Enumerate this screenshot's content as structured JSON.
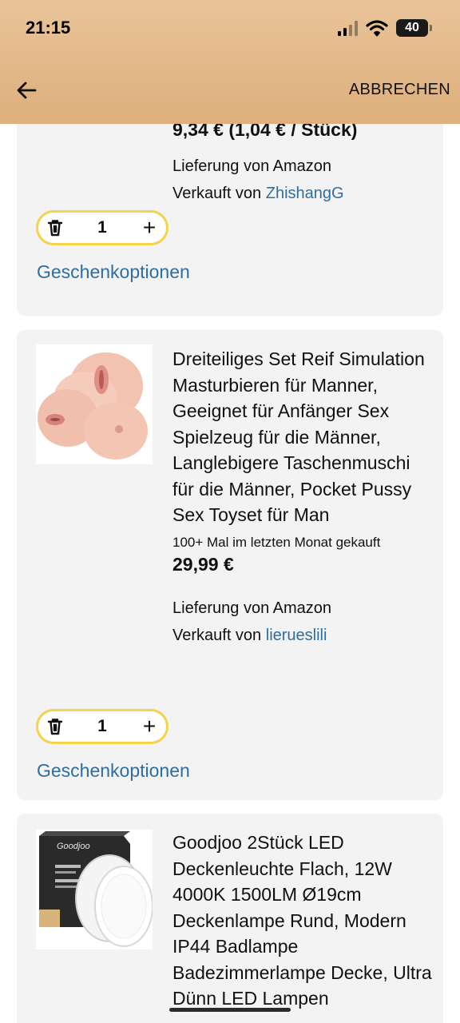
{
  "status_bar": {
    "time": "21:15",
    "battery": "40"
  },
  "header": {
    "cancel_label": "ABBRECHEN"
  },
  "cart": {
    "items": [
      {
        "price_line": "9,34 € (1,04 € / Stück)",
        "delivery": "Lieferung von Amazon",
        "sold_by_prefix": "Verkauft von",
        "seller": "ZhishangG",
        "quantity": "1",
        "gift_options": "Geschenkoptionen"
      },
      {
        "title": "Dreiteiliges Set Reif Simulation Masturbieren für Manner, Geeignet für Anfänger Sex Spielzeug für die Männer, Langlebigere Taschenmuschi für die Männer, Pocket Pussy Sex Toyset für Man",
        "bought_info": "100+ Mal im letzten Monat gekauft",
        "price": "29,99 €",
        "delivery": "Lieferung von Amazon",
        "sold_by_prefix": "Verkauft von",
        "seller": "lierueslili",
        "quantity": "1",
        "gift_options": "Geschenkoptionen"
      },
      {
        "title": "Goodjoo 2Stück LED Deckenleuchte Flach, 12W 4000K 1500LM Ø19cm Deckenlampe Rund, Modern IP44 Badlampe Badezimmerlampe Decke, Ultra Dünn LED Lampen",
        "brand_on_box": "Goodjoo"
      }
    ]
  },
  "icons": [
    "back-arrow-icon",
    "trash-icon",
    "plus-icon",
    "signal-icon",
    "wifi-icon",
    "battery-icon"
  ]
}
